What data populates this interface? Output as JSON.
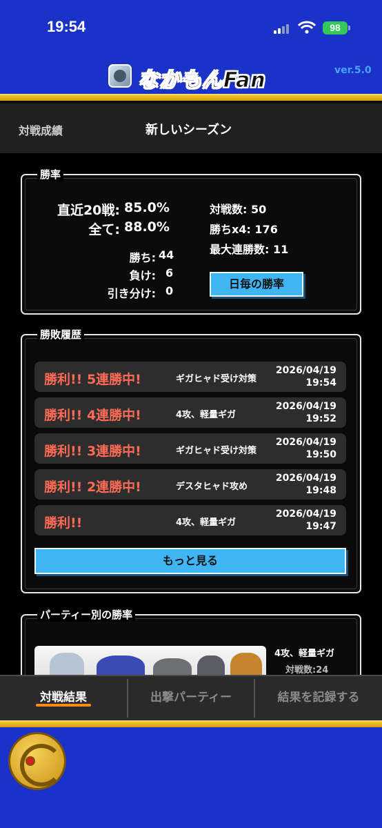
{
  "status_bar": {
    "time": "19:54",
    "battery": "98"
  },
  "header": {
    "app_title": "なかもんFan",
    "version": "ver.5.0"
  },
  "subheader": {
    "label": "対戦成績",
    "season": "新しいシーズン"
  },
  "win_rate": {
    "title": "勝率",
    "recent20_label": "直近20戦:",
    "recent20_value": "85.0%",
    "all_label": "全て:",
    "all_value": "88.0%",
    "wins_label": "勝ち:",
    "wins_value": "44",
    "losses_label": "負け:",
    "losses_value": "6",
    "draws_label": "引き分け:",
    "draws_value": "0",
    "battles": "対戦数: 50",
    "wins_x4": "勝ちx4: 176",
    "max_streak": "最大連勝数: 11",
    "daily_button": "日毎の勝率"
  },
  "history": {
    "title": "勝敗履歴",
    "rows": [
      {
        "result": "勝利!! 5連勝中!",
        "party": "ギガヒャド受け対策",
        "date": "2026/04/19",
        "time": "19:54"
      },
      {
        "result": "勝利!! 4連勝中!",
        "party": "4攻、軽量ギガ",
        "date": "2026/04/19",
        "time": "19:52"
      },
      {
        "result": "勝利!! 3連勝中!",
        "party": "ギガヒャド受け対策",
        "date": "2026/04/19",
        "time": "19:50"
      },
      {
        "result": "勝利!! 2連勝中!",
        "party": "デスタヒャド攻め",
        "date": "2026/04/19",
        "time": "19:48"
      },
      {
        "result": "勝利!!",
        "party": "4攻、軽量ギガ",
        "date": "2026/04/19",
        "time": "19:47"
      }
    ],
    "more_button": "もっと見る"
  },
  "party_stats": {
    "title": "パーティー別の勝率",
    "party_name": "4攻、軽量ギガ",
    "battles": "対戦数:24"
  },
  "tabs": [
    {
      "label": "対戦結果",
      "active": true
    },
    {
      "label": "出撃パーティー",
      "active": false
    },
    {
      "label": "結果を記録する",
      "active": false
    }
  ],
  "colors": {
    "header_blue": "#1b32c8",
    "gold": "#f4c52a",
    "accent_blue": "#3fb6f3",
    "win_red": "#ff6b56",
    "tab_accent": "#ff8a1a"
  }
}
